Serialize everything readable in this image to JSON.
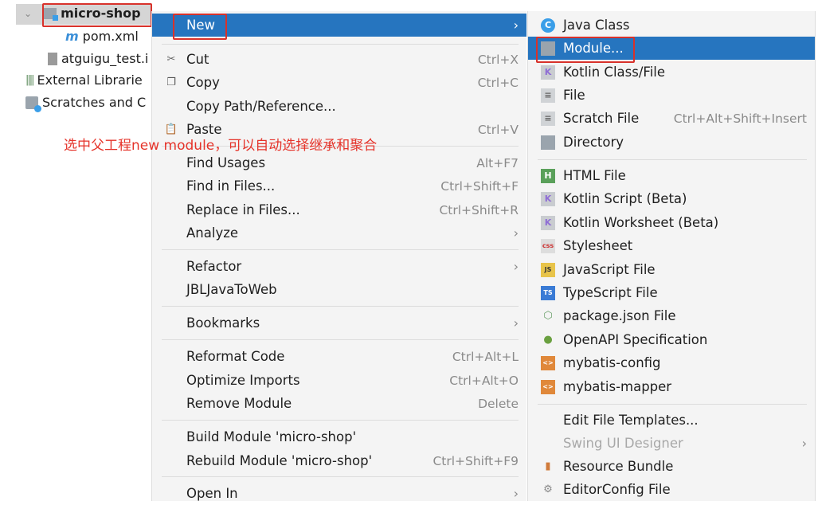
{
  "tree": {
    "items": [
      {
        "label": "micro-shop",
        "icon": "module-folder-icon"
      },
      {
        "label": "pom.xml",
        "icon": "maven-icon"
      },
      {
        "label": "atguigu_test.i",
        "icon": "iml-file-icon"
      },
      {
        "label": "External Librarie",
        "icon": "libraries-icon"
      },
      {
        "label": "Scratches and C",
        "icon": "scratches-icon"
      }
    ]
  },
  "annotation": "选中父工程new module，可以自动选择继承和聚合",
  "colors": {
    "selection": "#2675bf",
    "highlight_box": "#d8322b",
    "annotation": "#e5332a"
  },
  "menu": {
    "items": [
      {
        "label": "New",
        "submenu": true,
        "selected": true
      },
      {
        "sep": true
      },
      {
        "label": "Cut",
        "shortcut": "Ctrl+X",
        "icon": "scissors-icon"
      },
      {
        "label": "Copy",
        "shortcut": "Ctrl+C",
        "icon": "copy-icon"
      },
      {
        "label": "Copy Path/Reference..."
      },
      {
        "label": "Paste",
        "shortcut": "Ctrl+V",
        "icon": "clipboard-icon"
      },
      {
        "sep": true
      },
      {
        "label": "Find Usages",
        "shortcut": "Alt+F7"
      },
      {
        "label": "Find in Files...",
        "shortcut": "Ctrl+Shift+F"
      },
      {
        "label": "Replace in Files...",
        "shortcut": "Ctrl+Shift+R"
      },
      {
        "label": "Analyze",
        "submenu": true
      },
      {
        "sep": true
      },
      {
        "label": "Refactor",
        "submenu": true
      },
      {
        "label": "JBLJavaToWeb"
      },
      {
        "sep": true
      },
      {
        "label": "Bookmarks",
        "submenu": true
      },
      {
        "sep": true
      },
      {
        "label": "Reformat Code",
        "shortcut": "Ctrl+Alt+L"
      },
      {
        "label": "Optimize Imports",
        "shortcut": "Ctrl+Alt+O"
      },
      {
        "label": "Remove Module",
        "shortcut": "Delete"
      },
      {
        "sep": true
      },
      {
        "label": "Build Module 'micro-shop'"
      },
      {
        "label": "Rebuild Module 'micro-shop'",
        "shortcut": "Ctrl+Shift+F9"
      },
      {
        "sep": true
      },
      {
        "label": "Open In",
        "submenu": true
      }
    ]
  },
  "submenu": {
    "items": [
      {
        "label": "Java Class",
        "icon": "java-class-icon"
      },
      {
        "label": "Module...",
        "icon": "module-folder-icon",
        "selected": true
      },
      {
        "label": "Kotlin Class/File",
        "icon": "kotlin-file-icon"
      },
      {
        "label": "File",
        "icon": "file-icon"
      },
      {
        "label": "Scratch File",
        "shortcut": "Ctrl+Alt+Shift+Insert",
        "icon": "scratch-file-icon"
      },
      {
        "label": "Directory",
        "icon": "folder-icon"
      },
      {
        "sep": true
      },
      {
        "label": "HTML File",
        "icon": "html-file-icon"
      },
      {
        "label": "Kotlin Script (Beta)",
        "icon": "kotlin-script-icon"
      },
      {
        "label": "Kotlin Worksheet (Beta)",
        "icon": "kotlin-worksheet-icon"
      },
      {
        "label": "Stylesheet",
        "icon": "css-file-icon"
      },
      {
        "label": "JavaScript File",
        "icon": "js-file-icon"
      },
      {
        "label": "TypeScript File",
        "icon": "ts-file-icon"
      },
      {
        "label": "package.json File",
        "icon": "nodejs-icon"
      },
      {
        "label": "OpenAPI Specification",
        "icon": "openapi-icon"
      },
      {
        "label": "mybatis-config",
        "icon": "xml-file-icon"
      },
      {
        "label": "mybatis-mapper",
        "icon": "xml-file-icon"
      },
      {
        "sep": true
      },
      {
        "label": "Edit File Templates..."
      },
      {
        "label": "Swing UI Designer",
        "submenu": true,
        "disabled": true
      },
      {
        "label": "Resource Bundle",
        "icon": "resource-bundle-icon"
      },
      {
        "label": "EditorConfig File",
        "icon": "gear-icon"
      }
    ]
  }
}
